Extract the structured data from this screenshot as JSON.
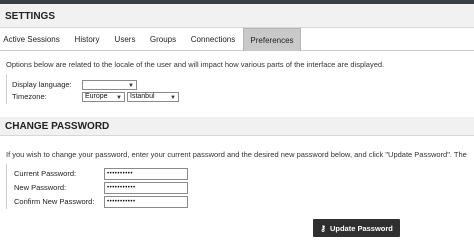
{
  "settings": {
    "title": "SETTINGS"
  },
  "tabs": [
    {
      "label": "Active Sessions",
      "active": false
    },
    {
      "label": "History",
      "active": false
    },
    {
      "label": "Users",
      "active": false
    },
    {
      "label": "Groups",
      "active": false
    },
    {
      "label": "Connections",
      "active": false
    },
    {
      "label": "Preferences",
      "active": true
    }
  ],
  "preferences": {
    "description": "Options below are related to the locale of the user and will impact how various parts of the interface are displayed.",
    "display_language_label": "Display language:",
    "display_language_value": "",
    "timezone_label": "Timezone:",
    "timezone_region": "Europe",
    "timezone_city": "Istanbul"
  },
  "change_password": {
    "title": "CHANGE PASSWORD",
    "description": "If you wish to change your password, enter your current password and the desired new password below, and click \"Update Password\". The",
    "current_label": "Current Password:",
    "current_value": "••••••••••",
    "new_label": "New Password:",
    "new_value": "•••••••••••",
    "confirm_label": "Confirm New Password:",
    "confirm_value": "•••••••••••",
    "button_label": "Update Password",
    "button_icon": "key-icon"
  }
}
